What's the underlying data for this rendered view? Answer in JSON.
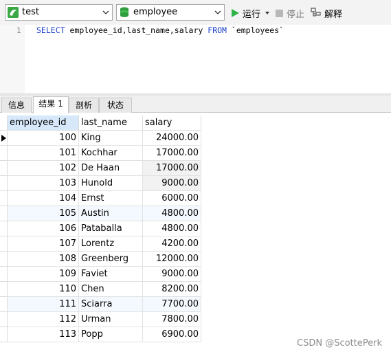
{
  "toolbar": {
    "connection": "test",
    "database": "employee",
    "run_label": "运行",
    "stop_label": "停止",
    "explain_label": "解释"
  },
  "editor": {
    "line_number": "1",
    "kw_select": "SELECT",
    "columns": " employee_id,last_name,salary ",
    "kw_from": "FROM",
    "table": " `employees`"
  },
  "tabs": [
    "信息",
    "结果 1",
    "剖析",
    "状态"
  ],
  "grid": {
    "columns": [
      "employee_id",
      "last_name",
      "salary"
    ],
    "rows": [
      [
        "100",
        "King",
        "24000.00"
      ],
      [
        "101",
        "Kochhar",
        "17000.00"
      ],
      [
        "102",
        "De Haan",
        "17000.00"
      ],
      [
        "103",
        "Hunold",
        "9000.00"
      ],
      [
        "104",
        "Ernst",
        "6000.00"
      ],
      [
        "105",
        "Austin",
        "4800.00"
      ],
      [
        "106",
        "Pataballa",
        "4800.00"
      ],
      [
        "107",
        "Lorentz",
        "4200.00"
      ],
      [
        "108",
        "Greenberg",
        "12000.00"
      ],
      [
        "109",
        "Faviet",
        "9000.00"
      ],
      [
        "110",
        "Chen",
        "8200.00"
      ],
      [
        "111",
        "Sciarra",
        "7700.00"
      ],
      [
        "112",
        "Urman",
        "7800.00"
      ],
      [
        "113",
        "Popp",
        "6900.00"
      ]
    ]
  },
  "watermark": "CSDN @ScottePerk",
  "colors": {
    "keyword": "#1a3fcc",
    "header_selected": "#d6e8fa",
    "run_green": "#2db34a",
    "db_green": "#2e9e3e"
  }
}
